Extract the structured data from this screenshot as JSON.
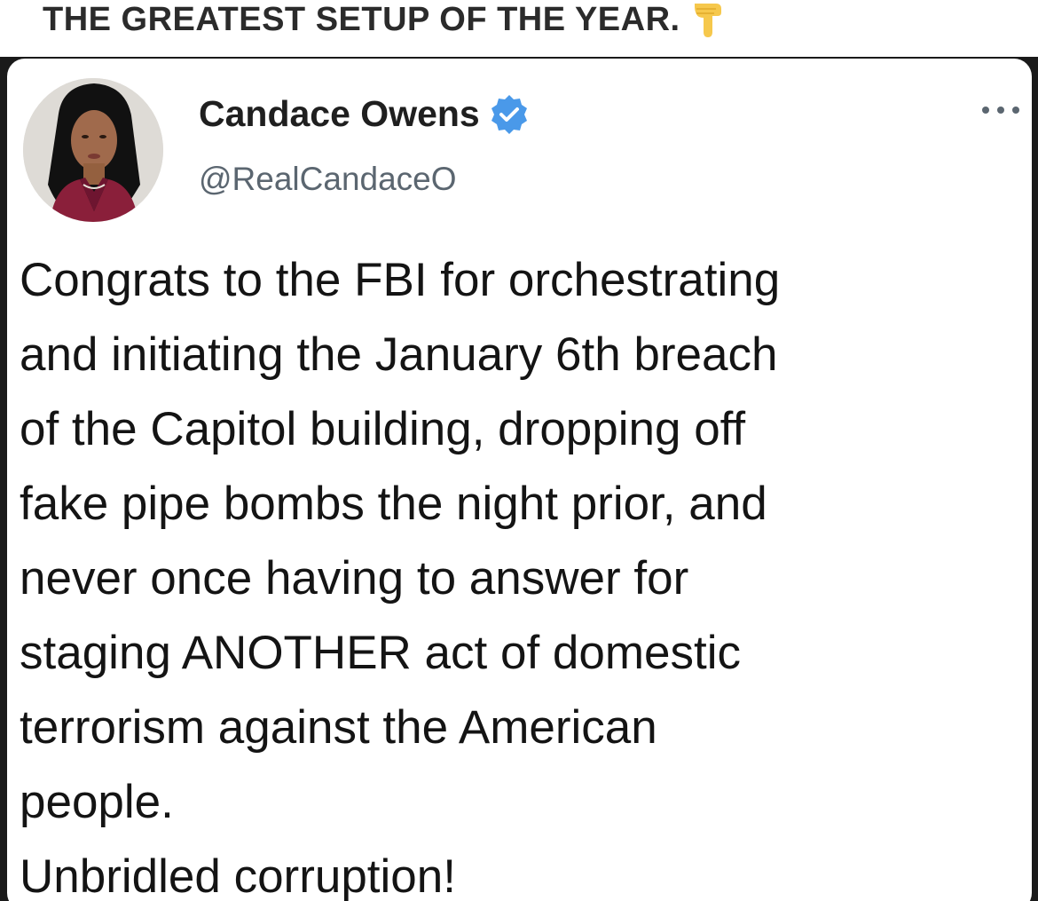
{
  "headline": {
    "text": "THE GREATEST SETUP OF THE YEAR.",
    "emoji": "pointing-down-icon"
  },
  "tweet": {
    "display_name": "Candace Owens",
    "handle": "@RealCandaceO",
    "verified": true,
    "body_lines": [
      "Congrats to the FBI for orchestrating",
      "and initiating the January 6th breach",
      "of the Capitol building, dropping off",
      "fake pipe bombs the night prior, and",
      "never once having to answer for",
      "staging ANOTHER act of domestic",
      "terrorism against the American",
      "people.",
      "Unbridled corruption!"
    ]
  },
  "colors": {
    "verified_blue": "#4a99e9",
    "handle_gray": "#5b6670",
    "body_text": "#141414",
    "headline_text": "#2b2b2b"
  }
}
